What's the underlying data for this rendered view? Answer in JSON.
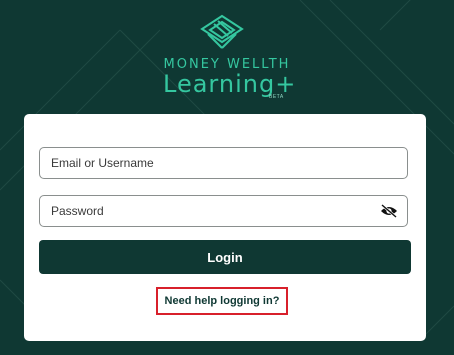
{
  "brand": {
    "line1": "MONEY WELLTH",
    "line2": "Learning+",
    "beta": "BETA"
  },
  "login_form": {
    "email_placeholder": "Email or Username",
    "password_placeholder": "Password",
    "login_label": "Login",
    "help_link": "Need help logging in?"
  },
  "icons": {
    "logo": "money-wellth-logo-icon",
    "password_toggle": "eye-slash-icon"
  },
  "colors": {
    "background": "#0f3833",
    "brand_accent": "#35c7a0",
    "button": "#0f3833",
    "highlight_box": "#d8202b"
  }
}
